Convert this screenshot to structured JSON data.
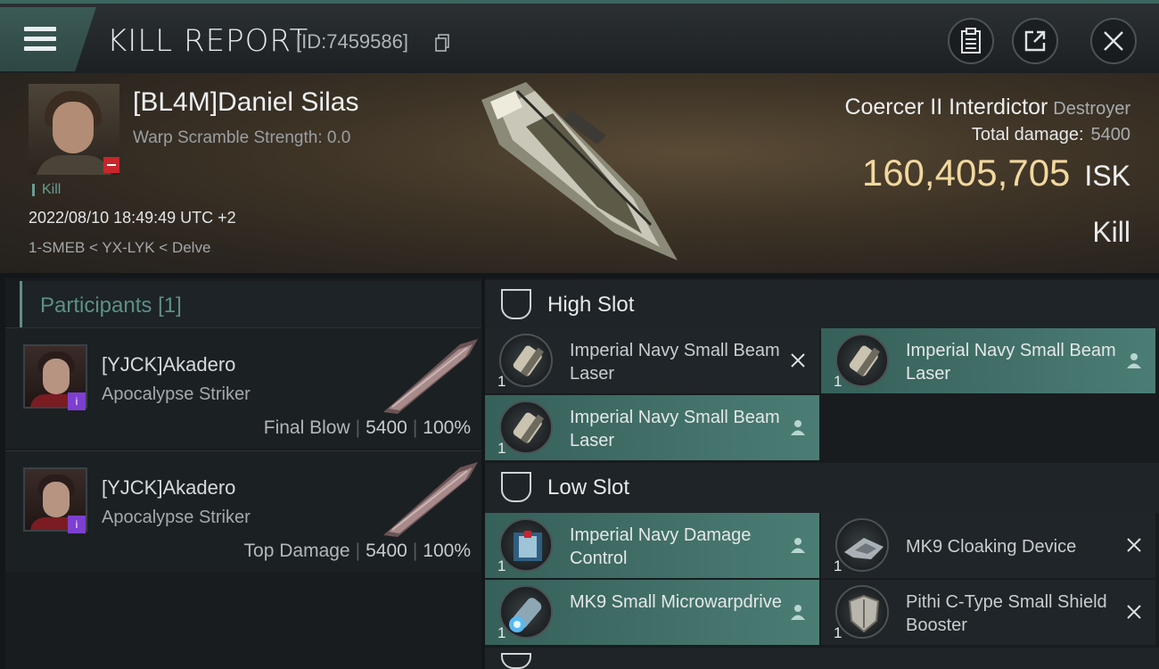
{
  "header": {
    "title": "KILL REPORT",
    "report_id": "[ID:7459586]"
  },
  "victim": {
    "name": "[BL4M]Daniel Silas",
    "warp_scramble": "Warp Scramble Strength: 0.0",
    "kill_tag": "Kill",
    "datetime": "2022/08/10 18:49:49 UTC +2",
    "location": "1-SMEB < YX-LYK < Delve",
    "ship_name": "Coercer II Interdictor",
    "ship_class": "Destroyer",
    "total_damage_label": "Total damage:",
    "total_damage_value": "5400",
    "isk_value": "160,405,705",
    "isk_unit": "ISK",
    "result": "Kill"
  },
  "participants": {
    "title": "Participants",
    "count": "[1]",
    "items": [
      {
        "name": "[YJCK]Akadero",
        "ship": "Apocalypse Striker",
        "role": "Final Blow",
        "damage": "5400",
        "percent": "100%"
      },
      {
        "name": "[YJCK]Akadero",
        "ship": "Apocalypse Striker",
        "role": "Top Damage",
        "damage": "5400",
        "percent": "100%"
      }
    ]
  },
  "fittings": {
    "high_slot_label": "High Slot",
    "low_slot_label": "Low Slot",
    "high": [
      {
        "name": "Imperial Navy Small Beam Laser",
        "qty": "1",
        "status": "destroyed"
      },
      {
        "name": "Imperial Navy Small Beam Laser",
        "qty": "1",
        "status": "dropped"
      },
      {
        "name": "Imperial Navy Small Beam Laser",
        "qty": "1",
        "status": "dropped"
      }
    ],
    "low": [
      {
        "name": "Imperial Navy Damage Control",
        "qty": "1",
        "status": "dropped"
      },
      {
        "name": "MK9 Cloaking Device",
        "qty": "1",
        "status": "destroyed"
      },
      {
        "name": "MK9 Small Microwarpdrive",
        "qty": "1",
        "status": "dropped"
      },
      {
        "name": "Pithi C-Type Small Shield Booster",
        "qty": "1",
        "status": "destroyed"
      }
    ]
  },
  "icons": {
    "menu": "hamburger-menu-icon",
    "clipboard": "clipboard-icon",
    "share": "share-icon",
    "close": "close-icon",
    "copy": "copy-icon",
    "slot": "slot-icon",
    "person": "person-icon",
    "x": "x-mark-icon"
  },
  "colors": {
    "accent": "#4b7d75",
    "isk": "#f1d89e",
    "participants_title": "#5d8f89",
    "badge": "#7d3fd0",
    "victim_badge": "#c8262b"
  }
}
